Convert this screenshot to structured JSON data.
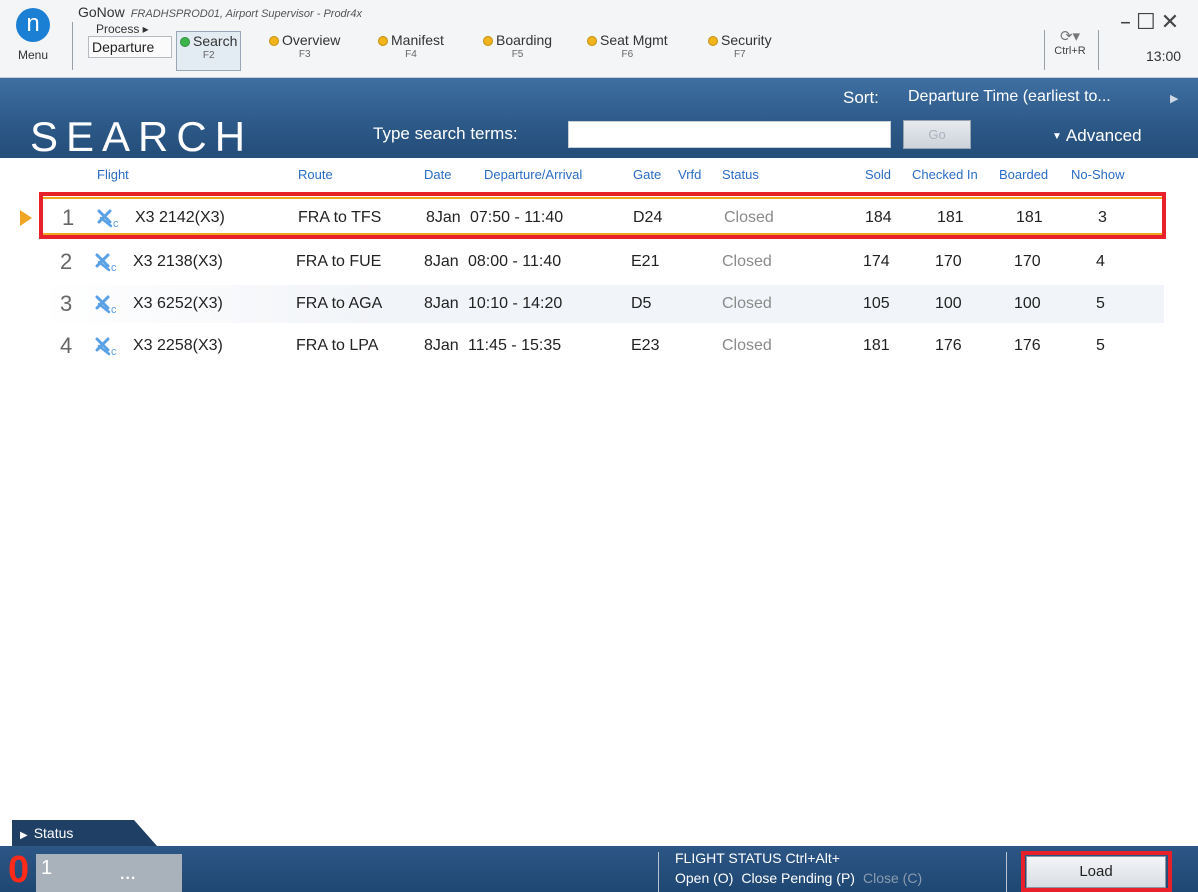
{
  "app": {
    "name": "GoNow",
    "subtitle": "FRADHSPROD01, Airport Supervisor - Prodr4x",
    "menu_label": "Menu",
    "menu_logo": "n",
    "process_label": "Process ▸",
    "mode_label": "Departure",
    "clock": "13:00",
    "refresh_shortcut": "Ctrl+R",
    "window_controls": "–☐✕"
  },
  "tabs": [
    {
      "label": "Search",
      "key": "F2",
      "status_color": "#3db54a",
      "active": true
    },
    {
      "label": "Overview",
      "key": "F3",
      "status_color": "#f2b31b"
    },
    {
      "label": "Manifest",
      "key": "F4",
      "status_color": "#f2b31b"
    },
    {
      "label": "Boarding",
      "key": "F5",
      "status_color": "#f2b31b"
    },
    {
      "label": "Seat Mgmt",
      "key": "F6",
      "status_color": "#f2b31b"
    },
    {
      "label": "Security",
      "key": "F7",
      "status_color": "#f2b31b"
    }
  ],
  "header": {
    "title": "SEARCH",
    "sort_label": "Sort:",
    "sort_value": "Departure Time (earliest to...",
    "search_label": "Type search terms:",
    "search_value": "",
    "go_label": "Go",
    "advanced_label": "Advanced"
  },
  "columns": {
    "flight": "Flight",
    "route": "Route",
    "date": "Date",
    "dep_arr": "Departure/Arrival",
    "gate": "Gate",
    "vrfd": "Vrfd",
    "status": "Status",
    "sold": "Sold",
    "checked_in": "Checked In",
    "boarded": "Boarded",
    "no_show": "No-Show"
  },
  "rows": [
    {
      "index": "1",
      "flight": "X3 2142(X3)",
      "route": "FRA to TFS",
      "date": "8Jan",
      "dep_arr": "07:50 - 11:40",
      "gate": "D24",
      "vrfd": "",
      "status": "Closed",
      "sold": "184",
      "checked_in": "181",
      "boarded": "181",
      "no_show": "3",
      "selected": true
    },
    {
      "index": "2",
      "flight": "X3 2138(X3)",
      "route": "FRA to FUE",
      "date": "8Jan",
      "dep_arr": "08:00 - 11:40",
      "gate": "E21",
      "vrfd": "",
      "status": "Closed",
      "sold": "174",
      "checked_in": "170",
      "boarded": "170",
      "no_show": "4"
    },
    {
      "index": "3",
      "flight": "X3 6252(X3)",
      "route": "FRA to AGA",
      "date": "8Jan",
      "dep_arr": "10:10 - 14:20",
      "gate": "D5",
      "vrfd": "",
      "status": "Closed",
      "sold": "105",
      "checked_in": "100",
      "boarded": "100",
      "no_show": "5"
    },
    {
      "index": "4",
      "flight": "X3 2258(X3)",
      "route": "FRA to LPA",
      "date": "8Jan",
      "dep_arr": "11:45 - 15:35",
      "gate": "E23",
      "vrfd": "",
      "status": "Closed",
      "sold": "181",
      "checked_in": "176",
      "boarded": "176",
      "no_show": "5"
    }
  ],
  "footer": {
    "status_tab": "Status",
    "alert_count": "0",
    "queue_count": "1",
    "more_label": "...",
    "flight_status_title": "FLIGHT STATUS   Ctrl+Alt+",
    "open_label": "Open (O)",
    "close_pending_label": "Close Pending (P)",
    "close_label": "Close (C)",
    "load_label": "Load"
  },
  "icons": {
    "flight_closed": "plane-closed-icon",
    "refresh": "refresh-icon",
    "expand": "triangle-right-icon"
  },
  "colors": {
    "header_blue": "#2d5a89",
    "accent_link": "#2a6cc4",
    "selection": "#f0a623",
    "highlight_red": "#e8202a",
    "alert_red": "#ff2a1a"
  }
}
